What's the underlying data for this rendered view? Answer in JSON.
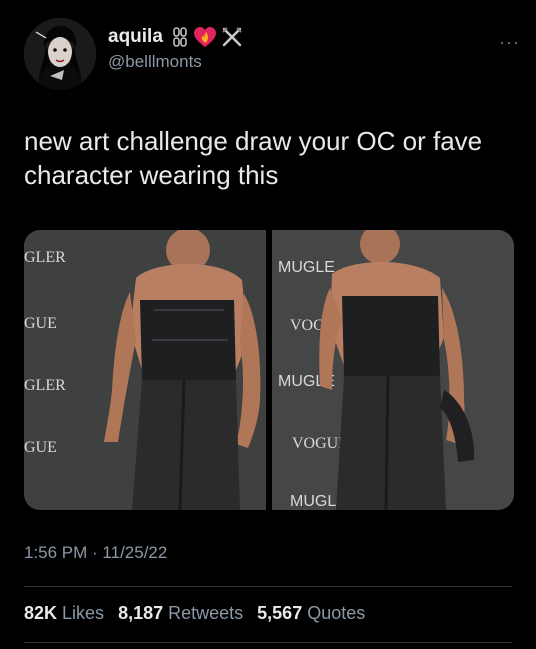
{
  "user": {
    "display_name": "aquila",
    "handle": "@belllmonts",
    "name_icons": [
      "chain-icon",
      "heart-fire-icon",
      "cross-swords-icon"
    ],
    "more_label": "···"
  },
  "tweet": {
    "text": "new art challenge draw your OC or fave character wearing this",
    "timestamp": "1:56 PM · 11/25/22"
  },
  "media": {
    "left_photo_backdrop": [
      "GLER",
      "GUE",
      "GLER",
      "GUE"
    ],
    "right_photo_backdrop": [
      "MUGLE",
      "VOGUE",
      "MUGLE",
      "VOGUE",
      "MUGLER"
    ]
  },
  "stats": {
    "likes_count": "82K",
    "likes_label": "Likes",
    "retweets_count": "8,187",
    "retweets_label": "Retweets",
    "quotes_count": "5,567",
    "quotes_label": "Quotes"
  },
  "colors": {
    "background": "#000000",
    "text": "#e7e9ea",
    "secondary": "#8b98a5",
    "divider": "#2f3336"
  }
}
